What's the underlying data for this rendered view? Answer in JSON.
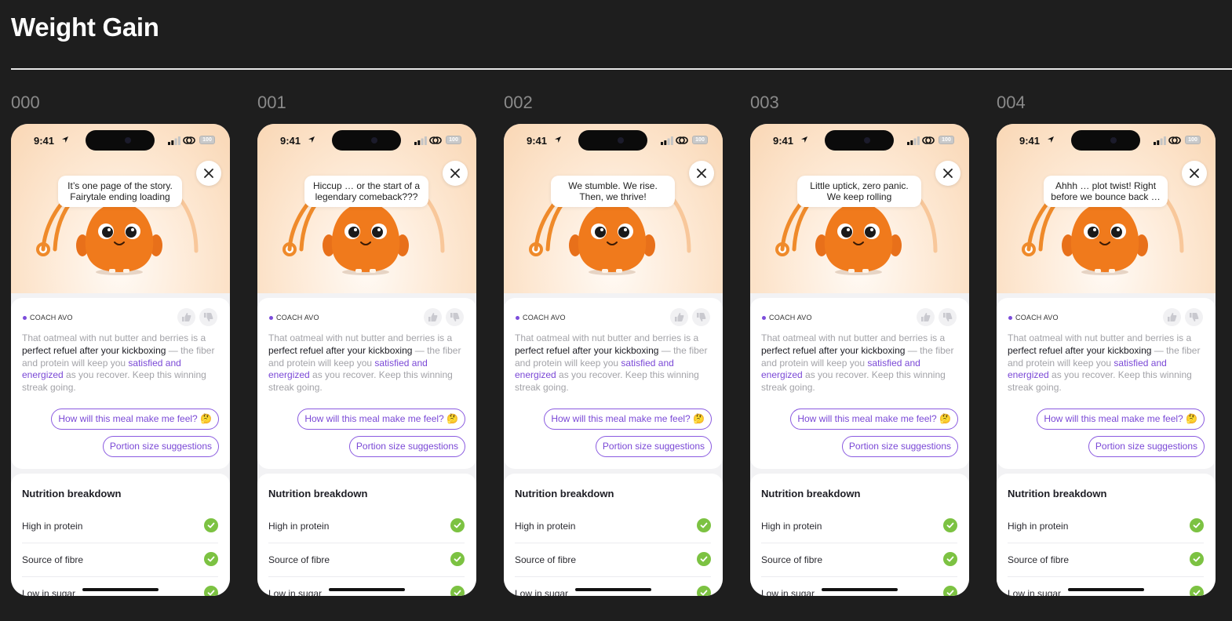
{
  "page": {
    "title": "Weight Gain"
  },
  "status": {
    "time": "9:41",
    "battery": "100"
  },
  "coach": {
    "name": "COACH AVO",
    "message": {
      "part1": "That oatmeal with nut butter and berries is a ",
      "part2": "perfect refuel after your kickboxing",
      "part3": " — the fiber and protein will keep you ",
      "part4": "satisfied and energized",
      "part5": " as you recover. Keep this winning streak going."
    }
  },
  "chips": {
    "question": "How will this meal make me feel? 🤔",
    "portion": "Portion size suggestions"
  },
  "nutrition": {
    "title": "Nutrition breakdown",
    "items": [
      "High in protein",
      "Source of fibre",
      "Low in sugar"
    ]
  },
  "frames": [
    {
      "label": "000",
      "bubble_line1": "It’s one page of the story.",
      "bubble_line2": "Fairytale ending loading"
    },
    {
      "label": "001",
      "bubble_line1": "Hiccup … or the start of a",
      "bubble_line2": "legendary comeback???"
    },
    {
      "label": "002",
      "bubble_line1": "We stumble. We rise.",
      "bubble_line2": "Then, we thrive!"
    },
    {
      "label": "003",
      "bubble_line1": "Little uptick, zero panic.",
      "bubble_line2": "We keep rolling"
    },
    {
      "label": "004",
      "bubble_line1": "Ahhh … plot twist! Right",
      "bubble_line2": "before we bounce back …"
    }
  ],
  "colors": {
    "accent": "#7a48d6",
    "mascot": "#f07a1c",
    "arc": "#ef8a2a",
    "check": "#7cc242",
    "background": "#1e1e1e"
  }
}
